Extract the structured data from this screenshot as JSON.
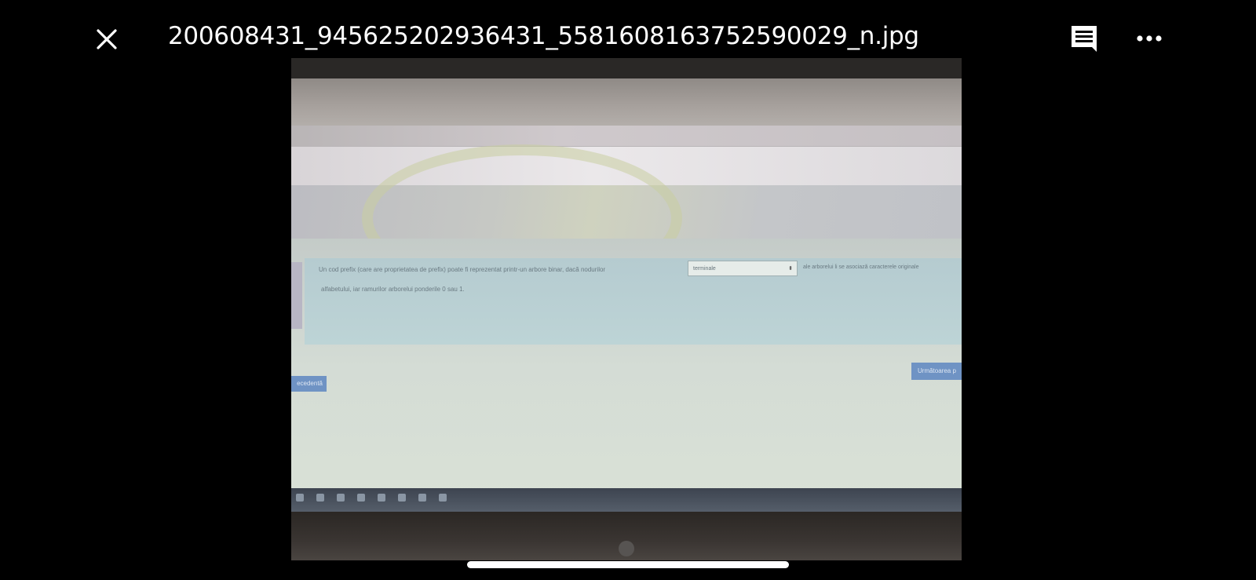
{
  "app": {
    "file_name": "200608431_945625202936431_5581608163752590029_n.jpg"
  },
  "toolbar": {
    "close_icon": "close-icon",
    "comment_icon": "comment-icon",
    "more_icon": "more-options-icon"
  },
  "photo": {
    "question_line1": "Un cod prefix (care are proprietatea de prefix) poate fi reprezentat printr-un arbore binar, dacă nodurilor",
    "dropdown_value": "terminale",
    "question_line1_end": "ale arborelui li se asociază caracterele originale",
    "question_line2": "alfabetului, iar ramurilor arborelui ponderile 0 sau 1.",
    "next_button": "Următoarea p",
    "prev_button": "ecedentă"
  },
  "colors": {
    "background": "#000000",
    "title_text": "#ffffff"
  }
}
